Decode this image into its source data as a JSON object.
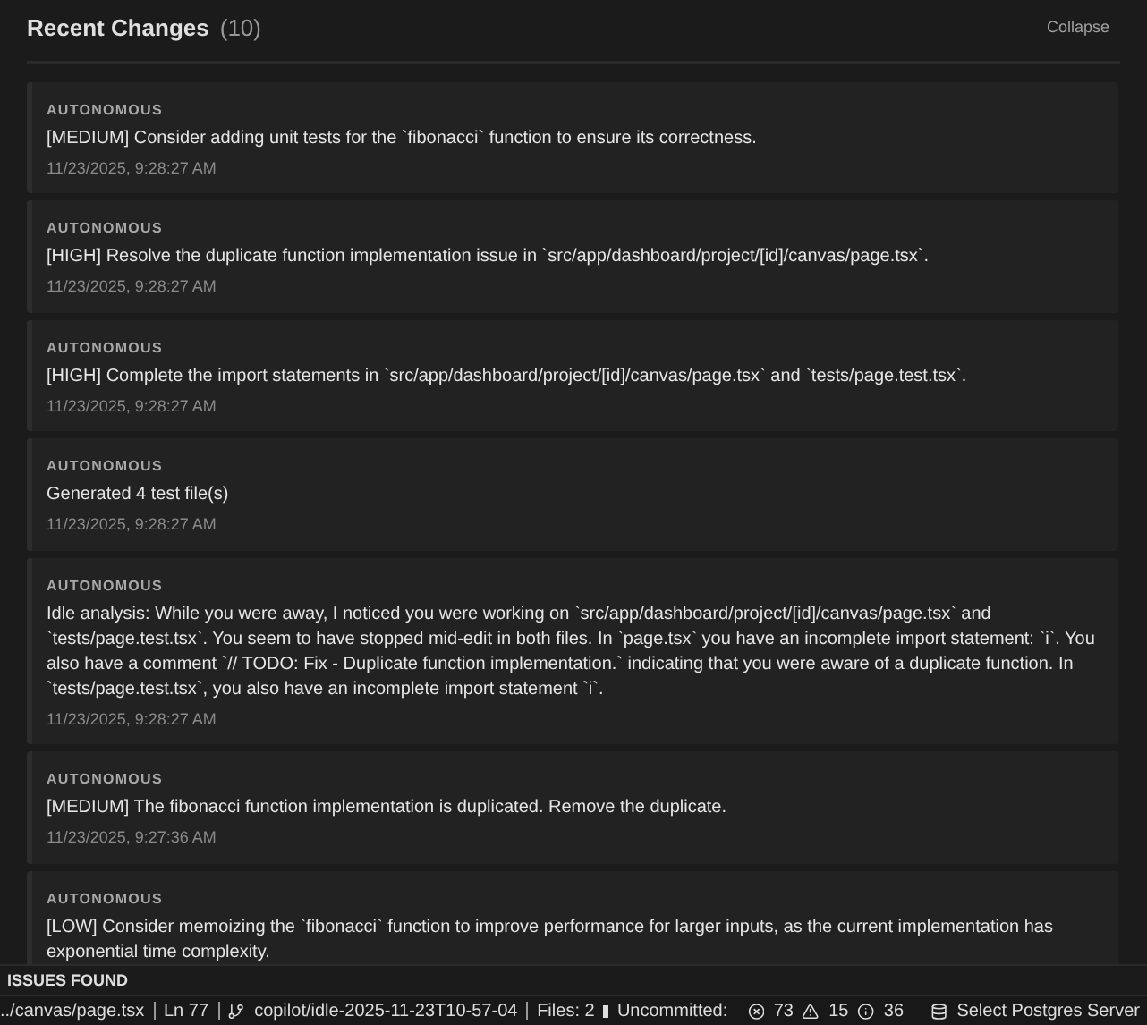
{
  "header": {
    "title": "Recent Changes",
    "count": "(10)",
    "collapse": "Collapse"
  },
  "changes": [
    {
      "source": "AUTONOMOUS",
      "message": "[MEDIUM] Consider adding unit tests for the `fibonacci` function to ensure its correctness.",
      "time": "11/23/2025, 9:28:27 AM"
    },
    {
      "source": "AUTONOMOUS",
      "message": "[HIGH] Resolve the duplicate function implementation issue in `src/app/dashboard/project/[id]/canvas/page.tsx`.",
      "time": "11/23/2025, 9:28:27 AM"
    },
    {
      "source": "AUTONOMOUS",
      "message": "[HIGH] Complete the import statements in `src/app/dashboard/project/[id]/canvas/page.tsx` and `tests/page.test.tsx`.",
      "time": "11/23/2025, 9:28:27 AM"
    },
    {
      "source": "AUTONOMOUS",
      "message": "Generated 4 test file(s)",
      "time": "11/23/2025, 9:28:27 AM"
    },
    {
      "source": "AUTONOMOUS",
      "message": "Idle analysis: While you were away, I noticed you were working on `src/app/dashboard/project/[id]/canvas/page.tsx` and `tests/page.test.tsx`. You seem to have stopped mid-edit in both files. In `page.tsx` you have an incomplete import statement: `i`. You also have a comment `// TODO: Fix - Duplicate function implementation.` indicating that you were aware of a duplicate function. In `tests/page.test.tsx`, you also have an incomplete import statement `i`.",
      "time": "11/23/2025, 9:28:27 AM"
    },
    {
      "source": "AUTONOMOUS",
      "message": "[MEDIUM] The fibonacci function implementation is duplicated. Remove the duplicate.",
      "time": "11/23/2025, 9:27:36 AM"
    },
    {
      "source": "AUTONOMOUS",
      "message": "[LOW] Consider memoizing the `fibonacci` function to improve performance for larger inputs, as the current implementation has exponential time complexity."
    }
  ],
  "issues_panel": {
    "title": "ISSUES FOUND"
  },
  "status_bar": {
    "file": "../canvas/page.tsx",
    "line": "Ln 77",
    "branch": "copilot/idle-2025-11-23T10-57-04",
    "files": "Files: 2",
    "uncommitted": "Uncommitted:",
    "errors": "73",
    "warnings": "15",
    "infos": "36",
    "server": "Select Postgres Server"
  }
}
